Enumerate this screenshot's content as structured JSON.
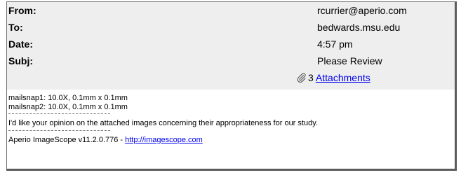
{
  "header": {
    "from_label": "From:",
    "from_value": "rcurrier@aperio.com",
    "to_label": "To:",
    "to_value": "bedwards.msu.edu",
    "date_label": "Date:",
    "date_value": "4:57 pm",
    "subj_label": "Subj:",
    "subj_value": "Please Review",
    "attachments_count": "3",
    "attachments_link": "Attachments",
    "attachment_icon": "paperclip-icon"
  },
  "body": {
    "lines": [
      "mailsnap1: 10.0X, 0.1mm x 0.1mm",
      "mailsnap2: 10.0X, 0.1mm x 0.1mm",
      "I'd like your opinion on the attached images concerning their appropriateness for our study."
    ],
    "footer_prefix": "Aperio ImageScope v11.2.0.776 - ",
    "footer_link": "http://imagescope.com"
  }
}
